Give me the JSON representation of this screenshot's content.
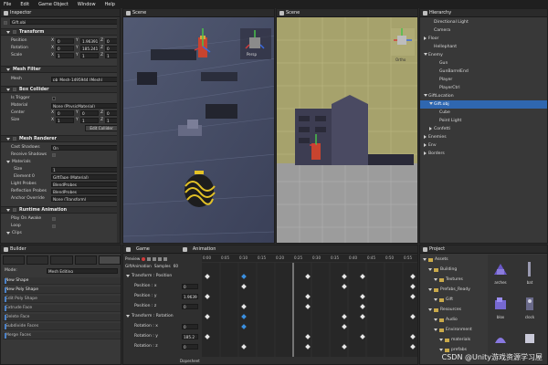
{
  "menubar": [
    "File",
    "Edit",
    "Game Object",
    "Window",
    "Help"
  ],
  "inspector": {
    "title": "Inspector",
    "object_name": "Gift.obj",
    "transform": {
      "label": "Transform",
      "position_label": "Position",
      "position": [
        "0",
        "1.96391",
        "0"
      ],
      "rotation_label": "Rotation",
      "rotation": [
        "0",
        "185.241",
        "0"
      ],
      "scale_label": "Scale",
      "scale": [
        "1",
        "1",
        "1"
      ],
      "axes": [
        "X",
        "Y",
        "Z"
      ]
    },
    "mesh_filter": {
      "label": "Mesh Filter",
      "mesh_label": "Mesh",
      "mesh_value": "pb_Mesh-1495944 (Mesh)"
    },
    "box_collider": {
      "label": "Box Collider",
      "is_trigger": "Is Trigger",
      "material_label": "Material",
      "material_value": "None (PhysicMaterial)",
      "center_label": "Center",
      "center": [
        "0",
        "0",
        "0"
      ],
      "size_label": "Size",
      "size": [
        "1",
        "1",
        "1"
      ],
      "edit_button": "Edit Collider"
    },
    "mesh_renderer": {
      "label": "Mesh Renderer",
      "cast_shadows_label": "Cast Shadows",
      "cast_shadows_value": "On",
      "receive_shadows_label": "Receive Shadows",
      "materials_label": "Materials",
      "size_label": "Size",
      "size_value": "1",
      "element_label": "Element 0",
      "element_value": "GiftTape (Material)",
      "light_probes_label": "Light Probes",
      "light_probes_value": "BlendProbes",
      "reflection_probes_label": "Reflection Probes",
      "reflection_probes_value": "BlendProbes",
      "anchor_override_label": "Anchor Override",
      "anchor_override_value": "None (Transform)"
    },
    "runtime_animation": {
      "label": "Runtime Animation",
      "play_on_awake": "Play On Awake",
      "loop": "Loop",
      "clips": "Clips"
    }
  },
  "scene_left": {
    "title": "Scene",
    "gizmo_label": "Persp"
  },
  "scene_right": {
    "title": "Scene",
    "gizmo_label": "Ortho"
  },
  "hierarchy": {
    "title": "Hierarchy",
    "items": [
      {
        "label": "Directional Light",
        "depth": 1,
        "arrow": ""
      },
      {
        "label": "Camera",
        "depth": 1,
        "arrow": ""
      },
      {
        "label": "Floor",
        "depth": 0,
        "arrow": "right"
      },
      {
        "label": "Hellephant",
        "depth": 1,
        "arrow": ""
      },
      {
        "label": "Enemy",
        "depth": 0,
        "arrow": "down"
      },
      {
        "label": "Gun",
        "depth": 2,
        "arrow": ""
      },
      {
        "label": "GunBarrelEnd",
        "depth": 2,
        "arrow": ""
      },
      {
        "label": "Player",
        "depth": 2,
        "arrow": ""
      },
      {
        "label": "PlayerCtrl",
        "depth": 2,
        "arrow": ""
      },
      {
        "label": "GiftLocation",
        "depth": 0,
        "arrow": "down"
      },
      {
        "label": "Gift.obj",
        "depth": 1,
        "arrow": "down",
        "selected": true
      },
      {
        "label": "Cube",
        "depth": 2,
        "arrow": ""
      },
      {
        "label": "Point Light",
        "depth": 2,
        "arrow": ""
      },
      {
        "label": "Confetti",
        "depth": 1,
        "arrow": "right"
      },
      {
        "label": "Enemies",
        "depth": 0,
        "arrow": "right"
      },
      {
        "label": "Env",
        "depth": 0,
        "arrow": "right"
      },
      {
        "label": "Borders",
        "depth": 0,
        "arrow": "right"
      }
    ]
  },
  "builder": {
    "title": "Builder",
    "mode_label": "Mode:",
    "mode_value": "Mesh Editing",
    "actions": [
      "New Shape",
      "New Poly Shape",
      "Edit Poly Shape",
      "Extrude Face",
      "Delete Face",
      "Subdivide Faces",
      "Merge Faces"
    ]
  },
  "game": {
    "title": "Game"
  },
  "animation": {
    "title": "Animation",
    "preview": "Preview",
    "clip": "GiftAnimation",
    "samples_label": "Samples",
    "samples_value": "60",
    "timeline": [
      "0:00",
      "0:05",
      "0:10",
      "0:15",
      "0:20",
      "0:25",
      "0:30",
      "0:35",
      "0:40",
      "0:45",
      "0:50",
      "0:55"
    ],
    "properties": [
      {
        "label": "Transform : Position",
        "kind": "group",
        "value": ""
      },
      {
        "label": "Position : x",
        "kind": "prop",
        "value": "0"
      },
      {
        "label": "Position : y",
        "kind": "prop",
        "value": "1.9639"
      },
      {
        "label": "Position : z",
        "kind": "prop",
        "value": "0"
      },
      {
        "label": "Transform : Rotation",
        "kind": "group",
        "value": ""
      },
      {
        "label": "Rotation : x",
        "kind": "prop",
        "value": "0"
      },
      {
        "label": "Rotation : y",
        "kind": "prop",
        "value": "185.2"
      },
      {
        "label": "Rotation : z",
        "kind": "prop",
        "value": "0"
      }
    ],
    "dopesheet": "Dopesheet"
  },
  "project": {
    "title": "Project",
    "tree": [
      {
        "label": "Assets",
        "depth": 0
      },
      {
        "label": "Building",
        "depth": 1
      },
      {
        "label": "Textures",
        "depth": 2
      },
      {
        "label": "Prefabs_Ready",
        "depth": 1
      },
      {
        "label": "Gift",
        "depth": 2
      },
      {
        "label": "Resources",
        "depth": 1
      },
      {
        "label": "Audio",
        "depth": 2
      },
      {
        "label": "Environment",
        "depth": 2
      },
      {
        "label": "materials",
        "depth": 3
      },
      {
        "label": "prefabs",
        "depth": 3
      }
    ],
    "assets": [
      "arches",
      "bat",
      "blox",
      "clock",
      "",
      ""
    ]
  },
  "watermark": "CSDN @Unity游戏资源学习屋",
  "colors": {
    "selection": "#2f67b0",
    "key_blue": "#3a8fe0",
    "record_red": "#d23b3b"
  }
}
